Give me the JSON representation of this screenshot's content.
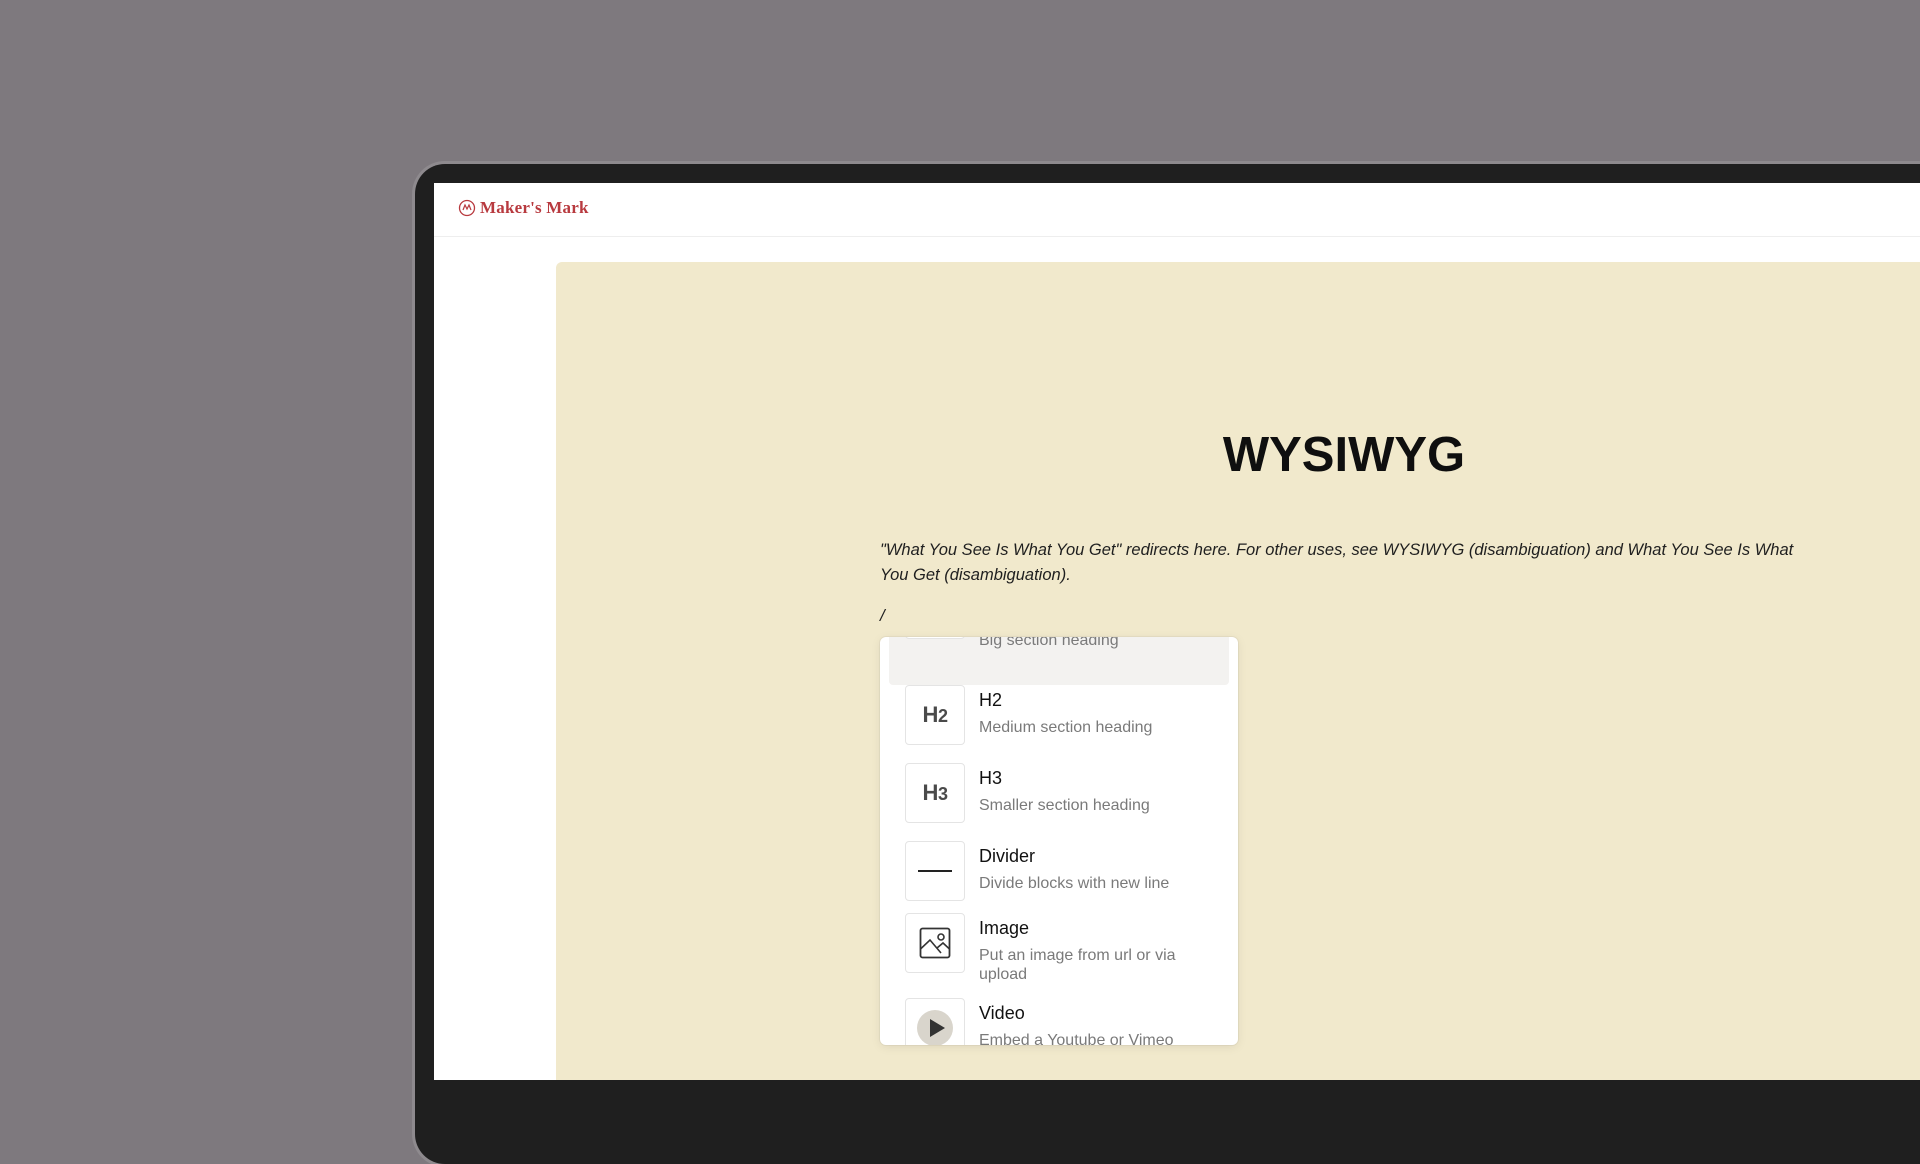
{
  "app": {
    "logo_text": "Maker's Mark"
  },
  "document": {
    "title": "WYSIWYG",
    "lead": "\"What You See Is What You Get\" redirects here. For other uses, see WYSIWYG (disambiguation) and What You See Is What You Get (disambiguation).",
    "slash_input": "/"
  },
  "menu": {
    "items": [
      {
        "title": "",
        "description": "Big section heading",
        "icon": "h1-icon"
      },
      {
        "title": "H2",
        "description": "Medium section heading",
        "icon": "h2-icon",
        "glyph": "H",
        "glyph_num": "2"
      },
      {
        "title": "H3",
        "description": "Smaller section heading",
        "icon": "h3-icon",
        "glyph": "H",
        "glyph_num": "3"
      },
      {
        "title": "Divider",
        "description": "Divide blocks with new line",
        "icon": "divider-icon"
      },
      {
        "title": "Image",
        "description": "Put an image from url or via upload",
        "icon": "image-icon"
      },
      {
        "title": "Video",
        "description": "Embed a Youtube or Vimeo video",
        "icon": "video-play-icon"
      }
    ]
  },
  "colors": {
    "background": "#7e797e",
    "editor_bg": "#f1e9cc",
    "brand": "#b83a3f"
  }
}
